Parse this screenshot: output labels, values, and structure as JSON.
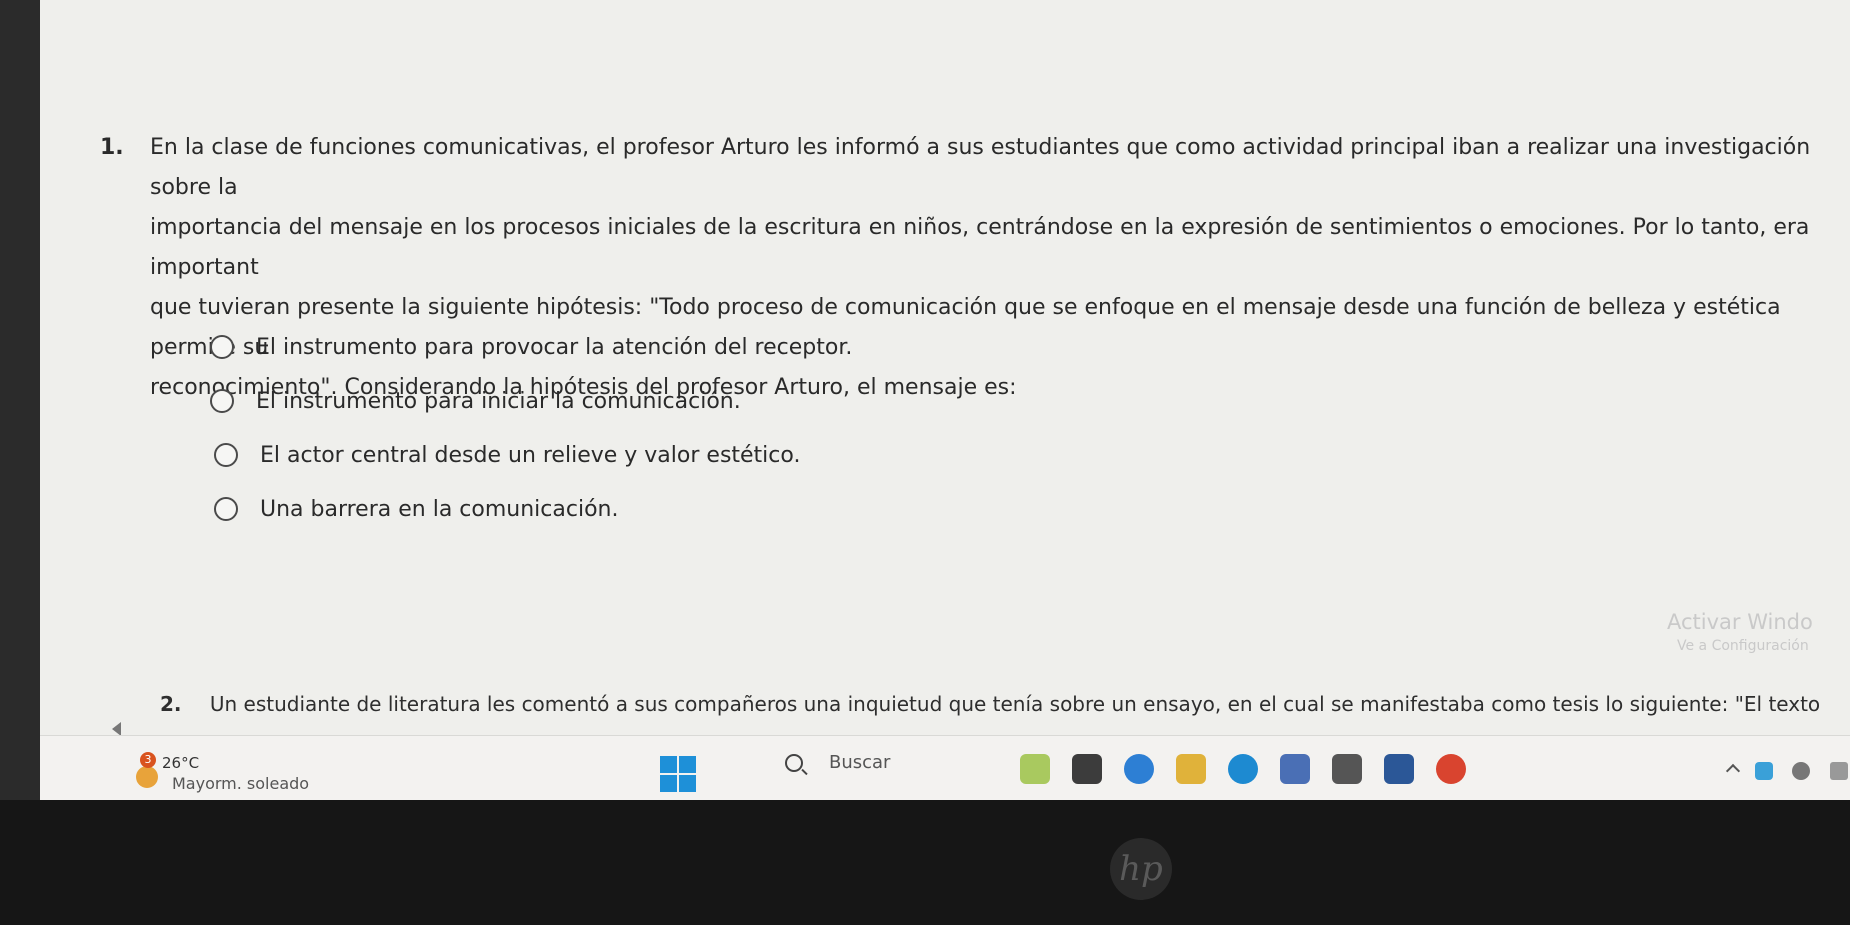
{
  "question1": {
    "number": "1.",
    "lines": [
      "En la clase de funciones comunicativas, el profesor Arturo les informó a sus estudiantes que como actividad principal iban a realizar una investigación sobre la",
      "importancia del mensaje en los procesos iniciales de la escritura en niños, centrándose en la expresión de sentimientos o emociones. Por lo tanto, era important",
      "que tuvieran presente la siguiente hipótesis: \"Todo proceso de comunicación que se enfoque en el mensaje desde una función de belleza y estética permite su",
      "reconocimiento\". Considerando la hipótesis del profesor Arturo, el mensaje es:"
    ],
    "options": [
      "El instrumento para provocar la atención del receptor.",
      "El instrumento para iniciar la comunicación.",
      "El actor central desde un relieve y valor estético.",
      "Una barrera en la comunicación."
    ]
  },
  "watermark": {
    "title": "Activar Windo",
    "subtitle": "Ve a Configuración"
  },
  "question2": {
    "number": "2.",
    "text": "Un estudiante de literatura les comentó a sus compañeros una inquietud que tenía sobre un ensayo, en el cual se manifestaba como tesis lo siguiente: \"El texto"
  },
  "taskbar": {
    "weather_badge": "3",
    "temperature": "26°C",
    "condition": "Mayorm. soleado",
    "search_label": "Buscar",
    "icons": [
      "widgets-icon",
      "file-explorer-icon",
      "copilot-icon",
      "folder-icon",
      "edge-icon",
      "store-icon",
      "settings-icon",
      "word-icon",
      "chrome-icon"
    ],
    "icon_colors": [
      "#a9c95f",
      "#3c3c3c",
      "#2d7fd4",
      "#e0b23a",
      "#1d8ad1",
      "#4a6fb5",
      "#555555",
      "#2b5797",
      "#d9442f"
    ]
  },
  "logo": "hp"
}
